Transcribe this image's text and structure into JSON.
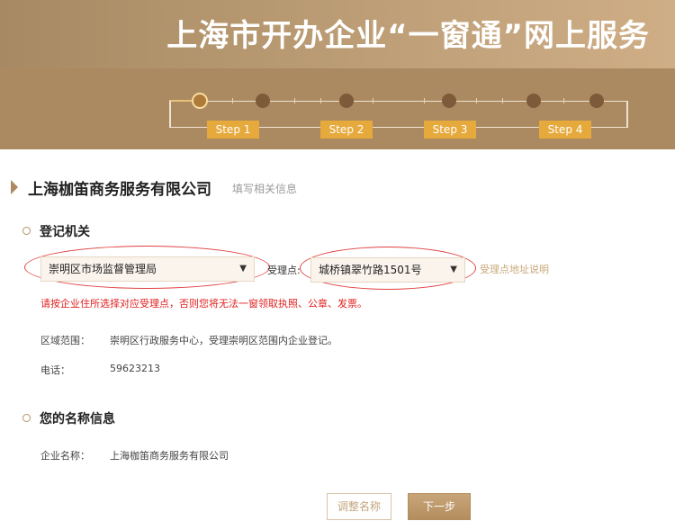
{
  "header": {
    "title": "上海市开办企业“一窗通”网上服务"
  },
  "steps": [
    {
      "label": "Step 1"
    },
    {
      "label": "Step 2"
    },
    {
      "label": "Step 3"
    },
    {
      "label": "Step 4"
    }
  ],
  "company": {
    "name": "上海枷笛商务服务有限公司",
    "hint": "填写相关信息"
  },
  "registration": {
    "section_title": "登记机关",
    "authority_select": {
      "value": "崇明区市场监督管理局"
    },
    "point_label": "受理点:",
    "point_select": {
      "value": "城桥镇翠竹路1501号"
    },
    "point_address_link": "受理点地址说明",
    "warning": "请按企业住所选择对应受理点，否则您将无法一窗领取执照、公章、发票。",
    "scope_label": "区域范围：",
    "scope_value": "崇明区行政服务中心，受理崇明区范围内企业登记。",
    "phone_label": "电话：",
    "phone_value": "59623213"
  },
  "name_info": {
    "section_title": "您的名称信息",
    "company_label": "企业名称：",
    "company_value": "上海枷笛商务服务有限公司"
  },
  "actions": {
    "adjust_label": "调整名称",
    "next_label": "下一步"
  },
  "colors": {
    "banner": "#ab8a61",
    "accent": "#e6a93b",
    "warning": "#e02020"
  }
}
